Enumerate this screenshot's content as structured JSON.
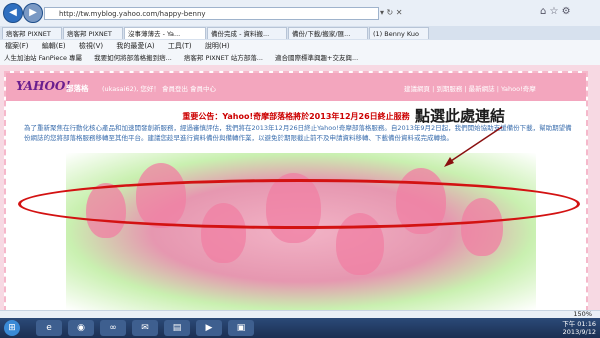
{
  "browser": {
    "address": "http://tw.myblog.yahoo.com/happy-benny",
    "tabs": [
      "痞客邦 PIXNET",
      "痞客邦 PIXNET",
      "沒事薄薄去 - Ya...",
      "備份完成 - 資料搬...",
      "備份/下載/搬家/匯...",
      "(1) Benny Kuo"
    ],
    "menu": [
      "檔案(F)",
      "編輯(E)",
      "檢視(V)",
      "我的最愛(A)",
      "工具(T)",
      "說明(H)"
    ],
    "favorites": [
      "人生加油站 FanPiece 專屬",
      "我要如何將部落格搬到痞...",
      "痞客邦 PIXNET 站方部落...",
      "適合國際標準興趣+交友興..."
    ],
    "zoom": "150%"
  },
  "page": {
    "logo": "YAHOO!",
    "blog_name": "部落格",
    "user_links": "(ukasai62), 您好！ 會員登出 會員中心",
    "right_links": "建議網頁 | 到期服務 | 最新網誌 | Yahoo!奇摩",
    "notice_title": "重要公告：Yahoo!奇摩部落格將於2013年12月26日終止服務",
    "notice_body": "為了重新聚焦在行動化核心產品和加速開發創新服務，經過審慎評估，我們將在2013年12月26日終止Yahoo!奇摩部落格服務。自2013年9月2日起，我們開始協助支援備份下載，幫助期望備份網誌的您將部落格服務移轉至其他平台。建議您趁早進行資料備份與備轉作業，以避免於期限截止前不及申請資料移轉、下載備份資料或完成轉換。"
  },
  "annotation": "點選此處連結",
  "taskbar": {
    "time": "下午 01:16",
    "date": "2013/9/12"
  }
}
